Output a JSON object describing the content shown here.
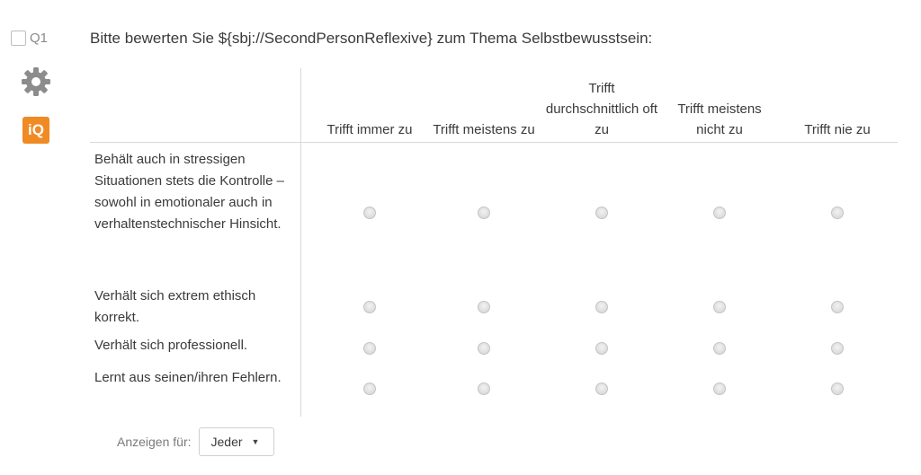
{
  "question": {
    "number": "Q1",
    "text": "Bitte bewerten Sie ${sbj://SecondPersonReflexive} zum Thema Selbstbewusstsein:"
  },
  "icons": {
    "settings": "gear-icon",
    "iq_badge": "iQ"
  },
  "matrix": {
    "columns": [
      "Trifft immer zu",
      "Trifft meistens zu",
      "Trifft durchschnittlich oft zu",
      "Trifft meistens nicht zu",
      "Trifft nie zu"
    ],
    "rows": [
      "Behält auch in stressigen Situationen stets die Kontrolle – sowohl in emotionaler auch in verhaltenstechnischer Hinsicht.",
      "Verhält sich extrem ethisch korrekt.",
      "Verhält sich professionell.",
      "Lernt aus seinen/ihren Fehlern."
    ]
  },
  "footer": {
    "show_for_label": "Anzeigen für:",
    "show_for_value": "Jeder"
  },
  "colors": {
    "accent": "#f08a24"
  }
}
